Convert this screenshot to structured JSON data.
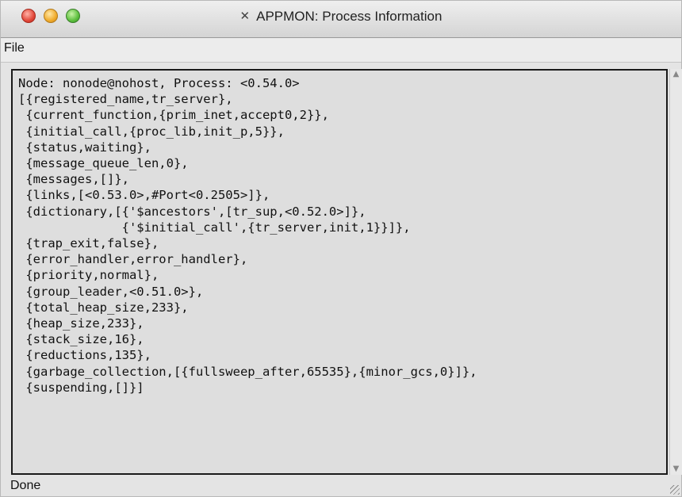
{
  "window": {
    "title": "APPMON: Process Information",
    "title_icon": "x11-icon"
  },
  "menu": {
    "file_label": "File"
  },
  "process_info": {
    "lines": [
      "Node: nonode@nohost, Process: <0.54.0>",
      "[{registered_name,tr_server},",
      " {current_function,{prim_inet,accept0,2}},",
      " {initial_call,{proc_lib,init_p,5}},",
      " {status,waiting},",
      " {message_queue_len,0},",
      " {messages,[]},",
      " {links,[<0.53.0>,#Port<0.2505>]},",
      " {dictionary,[{'$ancestors',[tr_sup,<0.52.0>]},",
      "              {'$initial_call',{tr_server,init,1}}]},",
      " {trap_exit,false},",
      " {error_handler,error_handler},",
      " {priority,normal},",
      " {group_leader,<0.51.0>},",
      " {total_heap_size,233},",
      " {heap_size,233},",
      " {stack_size,16},",
      " {reductions,135},",
      " {garbage_collection,[{fullsweep_after,65535},{minor_gcs,0}]},",
      " {suspending,[]}]"
    ]
  },
  "status": {
    "text": "Done"
  }
}
